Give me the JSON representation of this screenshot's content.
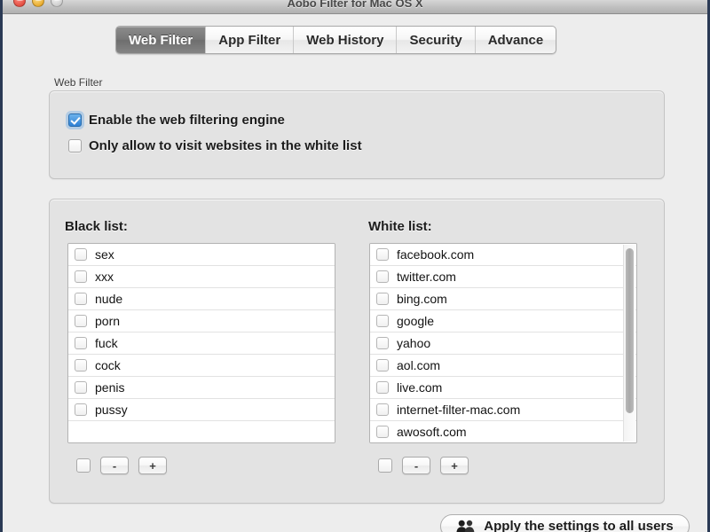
{
  "window": {
    "title": "Aobo Filter for Mac OS X",
    "controls": [
      {
        "name": "close",
        "color": "#e24b3f"
      },
      {
        "name": "minimize",
        "color": "#e7a92c"
      },
      {
        "name": "zoom",
        "color": "#cccccc"
      }
    ],
    "accent": "#2f80d4",
    "border_color": "#2b3a55"
  },
  "tabs": [
    {
      "label": "Web Filter",
      "selected": true
    },
    {
      "label": "App Filter",
      "selected": false
    },
    {
      "label": "Web History",
      "selected": false
    },
    {
      "label": "Security",
      "selected": false
    },
    {
      "label": "Advance",
      "selected": false
    }
  ],
  "web_filter_group": {
    "label": "Web Filter",
    "options": [
      {
        "label": "Enable the web filtering engine",
        "checked": true
      },
      {
        "label": "Only allow to visit websites in the white list",
        "checked": false
      }
    ]
  },
  "black_list": {
    "title": "Black list:",
    "items": [
      {
        "text": "sex",
        "checked": false
      },
      {
        "text": "xxx",
        "checked": false
      },
      {
        "text": "nude",
        "checked": false
      },
      {
        "text": "porn",
        "checked": false
      },
      {
        "text": "fuck",
        "checked": false
      },
      {
        "text": "cock",
        "checked": false
      },
      {
        "text": "penis",
        "checked": false
      },
      {
        "text": "pussy",
        "checked": false
      }
    ],
    "has_empty_row": true,
    "has_scrollbar": false,
    "tools": {
      "select_all_checked": false,
      "remove_label": "-",
      "add_label": "+"
    }
  },
  "white_list": {
    "title": "White list:",
    "items": [
      {
        "text": "facebook.com",
        "checked": false
      },
      {
        "text": "twitter.com",
        "checked": false
      },
      {
        "text": "bing.com",
        "checked": false
      },
      {
        "text": "google",
        "checked": false
      },
      {
        "text": "yahoo",
        "checked": false
      },
      {
        "text": "aol.com",
        "checked": false
      },
      {
        "text": "live.com",
        "checked": false
      },
      {
        "text": "internet-filter-mac.com",
        "checked": false
      },
      {
        "text": "awosoft.com",
        "checked": false
      }
    ],
    "has_empty_row": false,
    "has_scrollbar": true,
    "scroll_thumb_percent": 84,
    "tools": {
      "select_all_checked": false,
      "remove_label": "-",
      "add_label": "+"
    }
  },
  "footer": {
    "apply_label": "Apply the settings to all users",
    "apply_icon": "users-icon"
  }
}
